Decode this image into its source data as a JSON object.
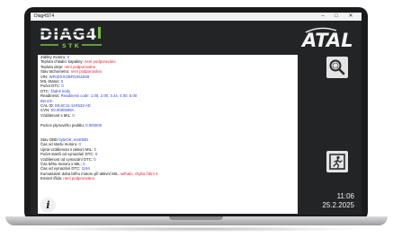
{
  "window": {
    "title": "Diag4ST4",
    "btn_min": "–",
    "btn_max": "□",
    "btn_close": "✕"
  },
  "logos": {
    "diag4": "DIAG4",
    "stk": "S T K",
    "atal": "ATAL"
  },
  "readout": {
    "lines": [
      [
        {
          "t": "Záblky motoru: "
        },
        {
          "t": "0",
          "c": "v"
        }
      ],
      [
        {
          "t": "Teplota chladicí kapaliny: "
        },
        {
          "t": "není podporováno",
          "c": "r"
        }
      ],
      [
        {
          "t": "Teplota oleje: "
        },
        {
          "t": "není podporováno",
          "c": "r"
        }
      ],
      [
        {
          "t": "Stav tachometru: "
        },
        {
          "t": "není podporováno",
          "c": "r"
        }
      ],
      [
        {
          "t": "VIN: "
        },
        {
          "t": "WF0DXXGBFDS61809",
          "c": "v"
        }
      ],
      [
        {
          "t": "MIL Status: "
        },
        {
          "t": "0",
          "c": "v"
        }
      ],
      [
        {
          "t": "Počet DTC: "
        },
        {
          "t": "0",
          "c": "v"
        }
      ],
      [
        {
          "t": "DTC: "
        },
        {
          "t": "žádné kódy",
          "c": "v"
        }
      ],
      [
        {
          "t": "Readiness: "
        },
        {
          "t": "Readiness code: 1.00, 2.00, 3.44, 4.00, 5.00",
          "c": "v"
        }
      ],
      [
        {
          "t": "Benzín",
          "c": "v"
        }
      ],
      [
        {
          "t": "CAL ID: "
        },
        {
          "t": "E8.6C11-12K532-AE",
          "c": "v"
        }
      ],
      [
        {
          "t": "CVN: "
        },
        {
          "t": "E0.0000608A",
          "c": "v"
        }
      ],
      [
        {
          "t": "Vzdálenost s MIL: "
        },
        {
          "t": "0",
          "c": "v"
        }
      ],
      [],
      [
        {
          "t": "Pozice plynového pedálu: "
        },
        {
          "t": "0.000000",
          "c": "v"
        }
      ],
      [],
      [],
      [
        {
          "t": "Stav OBD "
        },
        {
          "t": "byteOK, testOBD",
          "c": "v"
        }
      ],
      [
        {
          "t": "Čas od startu motoru: "
        },
        {
          "t": "0",
          "c": "v"
        }
      ],
      [
        {
          "t": "Ujetá vzdálenost s aktivní MIL: "
        },
        {
          "t": "0",
          "c": "v"
        }
      ],
      [
        {
          "t": "Počet startů od vymazání DTC: "
        },
        {
          "t": "0",
          "c": "v"
        }
      ],
      [
        {
          "t": "Vzdálenost od vymazání DTC: "
        },
        {
          "t": "0",
          "c": "v"
        }
      ],
      [
        {
          "t": "Čas běhu motoru s MIL: "
        },
        {
          "t": "0",
          "c": "v"
        }
      ],
      [
        {
          "t": "Čas od vymazání DTC: "
        },
        {
          "t": "1194",
          "c": "v"
        }
      ],
      [
        {
          "t": "Kumulativní doba běhu motoru při aktivní MIL: "
        },
        {
          "t": "selhalo, chyba čtění 2",
          "c": "r"
        }
      ],
      [
        {
          "t": "Emisní třída: "
        },
        {
          "t": "není podporováno",
          "c": "r"
        }
      ]
    ]
  },
  "buttons": {
    "info_glyph": "i"
  },
  "clock": {
    "time": "11:06",
    "date": "25.2.2025"
  },
  "colors": {
    "value_blue": "#2a3fd1",
    "error_red": "#e0162b",
    "stk_green": "#7ac143",
    "panel_dark": "#232426"
  }
}
